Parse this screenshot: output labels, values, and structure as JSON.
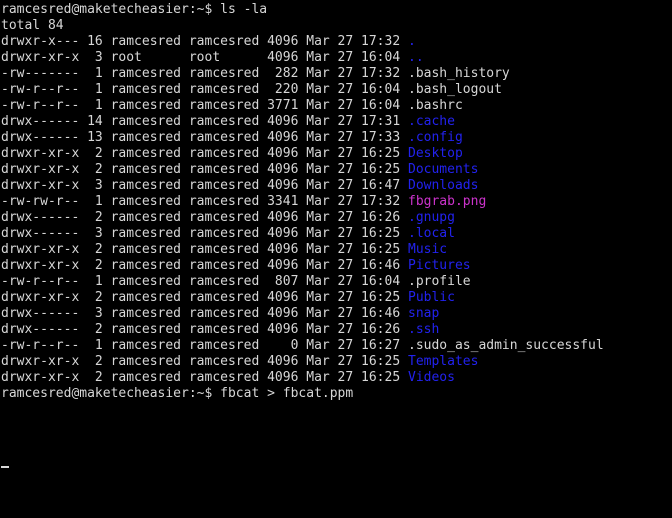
{
  "terminal": {
    "colors": {
      "background": "#000000",
      "foreground": "#d7d7d7",
      "directory": "#2222ee",
      "image_file": "#cc33cc"
    },
    "prompt": "ramcesred@maketecheasier:~$ ",
    "user": "ramcesred",
    "host": "maketecheasier",
    "cwd": "~",
    "cursor_glyph": "_"
  },
  "session": {
    "command_1": "ls -la",
    "total_line": "total 84",
    "command_2": "fbcat > fbcat.ppm"
  },
  "listing": {
    "columns": [
      "permissions",
      "links",
      "owner",
      "group",
      "size",
      "month",
      "day",
      "time",
      "name"
    ],
    "rows": [
      {
        "permissions": "drwxr-x---",
        "links": "16",
        "owner": "ramcesred",
        "group": "ramcesred",
        "size": "4096",
        "month": "Mar",
        "day": "27",
        "time": "17:32",
        "name": ".",
        "type": "dir"
      },
      {
        "permissions": "drwxr-xr-x",
        "links": "3",
        "owner": "root",
        "group": "root",
        "size": "4096",
        "month": "Mar",
        "day": "27",
        "time": "16:04",
        "name": "..",
        "type": "dir"
      },
      {
        "permissions": "-rw-------",
        "links": "1",
        "owner": "ramcesred",
        "group": "ramcesred",
        "size": "282",
        "month": "Mar",
        "day": "27",
        "time": "17:32",
        "name": ".bash_history",
        "type": "file"
      },
      {
        "permissions": "-rw-r--r--",
        "links": "1",
        "owner": "ramcesred",
        "group": "ramcesred",
        "size": "220",
        "month": "Mar",
        "day": "27",
        "time": "16:04",
        "name": ".bash_logout",
        "type": "file"
      },
      {
        "permissions": "-rw-r--r--",
        "links": "1",
        "owner": "ramcesred",
        "group": "ramcesred",
        "size": "3771",
        "month": "Mar",
        "day": "27",
        "time": "16:04",
        "name": ".bashrc",
        "type": "file"
      },
      {
        "permissions": "drwx------",
        "links": "14",
        "owner": "ramcesred",
        "group": "ramcesred",
        "size": "4096",
        "month": "Mar",
        "day": "27",
        "time": "17:31",
        "name": ".cache",
        "type": "dir"
      },
      {
        "permissions": "drwx------",
        "links": "13",
        "owner": "ramcesred",
        "group": "ramcesred",
        "size": "4096",
        "month": "Mar",
        "day": "27",
        "time": "17:33",
        "name": ".config",
        "type": "dir"
      },
      {
        "permissions": "drwxr-xr-x",
        "links": "2",
        "owner": "ramcesred",
        "group": "ramcesred",
        "size": "4096",
        "month": "Mar",
        "day": "27",
        "time": "16:25",
        "name": "Desktop",
        "type": "dir"
      },
      {
        "permissions": "drwxr-xr-x",
        "links": "2",
        "owner": "ramcesred",
        "group": "ramcesred",
        "size": "4096",
        "month": "Mar",
        "day": "27",
        "time": "16:25",
        "name": "Documents",
        "type": "dir"
      },
      {
        "permissions": "drwxr-xr-x",
        "links": "3",
        "owner": "ramcesred",
        "group": "ramcesred",
        "size": "4096",
        "month": "Mar",
        "day": "27",
        "time": "16:47",
        "name": "Downloads",
        "type": "dir"
      },
      {
        "permissions": "-rw-rw-r--",
        "links": "1",
        "owner": "ramcesred",
        "group": "ramcesred",
        "size": "3341",
        "month": "Mar",
        "day": "27",
        "time": "17:32",
        "name": "fbgrab.png",
        "type": "image"
      },
      {
        "permissions": "drwx------",
        "links": "2",
        "owner": "ramcesred",
        "group": "ramcesred",
        "size": "4096",
        "month": "Mar",
        "day": "27",
        "time": "16:26",
        "name": ".gnupg",
        "type": "dir"
      },
      {
        "permissions": "drwx------",
        "links": "3",
        "owner": "ramcesred",
        "group": "ramcesred",
        "size": "4096",
        "month": "Mar",
        "day": "27",
        "time": "16:25",
        "name": ".local",
        "type": "dir"
      },
      {
        "permissions": "drwxr-xr-x",
        "links": "2",
        "owner": "ramcesred",
        "group": "ramcesred",
        "size": "4096",
        "month": "Mar",
        "day": "27",
        "time": "16:25",
        "name": "Music",
        "type": "dir"
      },
      {
        "permissions": "drwxr-xr-x",
        "links": "2",
        "owner": "ramcesred",
        "group": "ramcesred",
        "size": "4096",
        "month": "Mar",
        "day": "27",
        "time": "16:46",
        "name": "Pictures",
        "type": "dir"
      },
      {
        "permissions": "-rw-r--r--",
        "links": "1",
        "owner": "ramcesred",
        "group": "ramcesred",
        "size": "807",
        "month": "Mar",
        "day": "27",
        "time": "16:04",
        "name": ".profile",
        "type": "file"
      },
      {
        "permissions": "drwxr-xr-x",
        "links": "2",
        "owner": "ramcesred",
        "group": "ramcesred",
        "size": "4096",
        "month": "Mar",
        "day": "27",
        "time": "16:25",
        "name": "Public",
        "type": "dir"
      },
      {
        "permissions": "drwx------",
        "links": "3",
        "owner": "ramcesred",
        "group": "ramcesred",
        "size": "4096",
        "month": "Mar",
        "day": "27",
        "time": "16:46",
        "name": "snap",
        "type": "dir"
      },
      {
        "permissions": "drwx------",
        "links": "2",
        "owner": "ramcesred",
        "group": "ramcesred",
        "size": "4096",
        "month": "Mar",
        "day": "27",
        "time": "16:26",
        "name": ".ssh",
        "type": "dir"
      },
      {
        "permissions": "-rw-r--r--",
        "links": "1",
        "owner": "ramcesred",
        "group": "ramcesred",
        "size": "0",
        "month": "Mar",
        "day": "27",
        "time": "16:27",
        "name": ".sudo_as_admin_successful",
        "type": "file"
      },
      {
        "permissions": "drwxr-xr-x",
        "links": "2",
        "owner": "ramcesred",
        "group": "ramcesred",
        "size": "4096",
        "month": "Mar",
        "day": "27",
        "time": "16:25",
        "name": "Templates",
        "type": "dir"
      },
      {
        "permissions": "drwxr-xr-x",
        "links": "2",
        "owner": "ramcesred",
        "group": "ramcesred",
        "size": "4096",
        "month": "Mar",
        "day": "27",
        "time": "16:25",
        "name": "Videos",
        "type": "dir"
      }
    ]
  }
}
